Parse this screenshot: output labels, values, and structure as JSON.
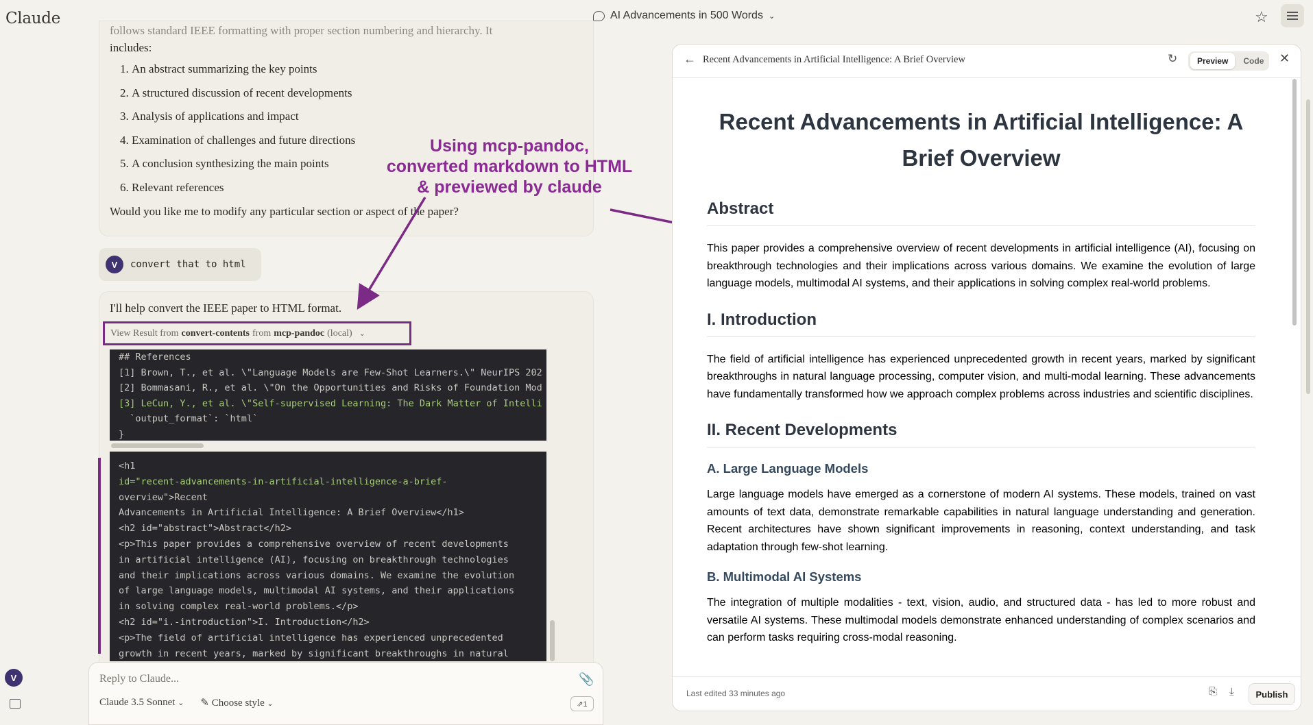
{
  "app": {
    "logo": "Claude",
    "conversation_title": "AI Advancements in 500 Words"
  },
  "assistant_message": {
    "faded_line": "follows standard IEEE formatting with proper section numbering and hierarchy. It",
    "intro_line": "includes:",
    "items": [
      "An abstract summarizing the key points",
      "A structured discussion of recent developments",
      "Analysis of applications and impact",
      "Examination of challenges and future directions",
      "A conclusion synthesizing the main points",
      "Relevant references"
    ],
    "closing": "Would you like me to modify any particular section or aspect of the paper?"
  },
  "user": {
    "avatar": "V",
    "message": "convert that to html"
  },
  "reply": {
    "text": "I'll help convert the IEEE paper to HTML format.",
    "view_result_prefix": "View Result from",
    "tool": "convert-contents",
    "from_word": "from",
    "server": "mcp-pandoc",
    "server_note": "(local)"
  },
  "code_block_1": [
    "## References",
    "[1] Brown, T., et al. \\\"Language Models are Few-Shot Learners.\\\" NeurIPS 202",
    "[2] Bommasani, R., et al. \\\"On the Opportunities and Risks of Foundation Mod",
    "[3] LeCun, Y., et al. \\\"Self-supervised Learning: The Dark Matter of Intelli",
    "  `output_format`: `html`",
    "}"
  ],
  "code_block_2": [
    "<h1",
    "id=\"recent-advancements-in-artificial-intelligence-a-brief-",
    "overview\">Recent",
    "Advancements in Artificial Intelligence: A Brief Overview</h1>",
    "<h2 id=\"abstract\">Abstract</h2>",
    "<p>This paper provides a comprehensive overview of recent developments",
    "in artificial intelligence (AI), focusing on breakthrough technologies",
    "and their implications across various domains. We examine the evolution",
    "of large language models, multimodal AI systems, and their applications",
    "in solving complex real-world problems.</p>",
    "<h2 id=\"i.-introduction\">I. Introduction</h2>",
    "<p>The field of artificial intelligence has experienced unprecedented",
    "growth in recent years, marked by significant breakthroughs in natural"
  ],
  "annotation": {
    "line1": "Using mcp-pandoc,",
    "line2": "converted markdown to HTML",
    "line3": "& previewed by claude"
  },
  "composer": {
    "placeholder": "Reply to Claude...",
    "model": "Claude 3.5 Sonnet",
    "style": "Choose style",
    "badge": "⇗1"
  },
  "sidebar": {
    "avatar": "V"
  },
  "preview": {
    "header_title": "Recent Advancements in Artificial Intelligence: A Brief Overview",
    "toggle_preview": "Preview",
    "toggle_code": "Code",
    "doc": {
      "title": "Recent Advancements in Artificial Intelligence: A Brief Overview",
      "abstract_h": "Abstract",
      "abstract_p": "This paper provides a comprehensive overview of recent developments in artificial intelligence (AI), focusing on breakthrough technologies and their implications across various domains. We examine the evolution of large language models, multimodal AI systems, and their applications in solving complex real-world problems.",
      "intro_h": "I. Introduction",
      "intro_p": "The field of artificial intelligence has experienced unprecedented growth in recent years, marked by significant breakthroughs in natural language processing, computer vision, and multi-modal learning. These advancements have fundamentally transformed how we approach complex problems across industries and scientific disciplines.",
      "dev_h": "II. Recent Developments",
      "llm_h": "A. Large Language Models",
      "llm_p": "Large language models have emerged as a cornerstone of modern AI systems. These models, trained on vast amounts of text data, demonstrate remarkable capabilities in natural language understanding and generation. Recent architectures have shown significant improvements in reasoning, context understanding, and task adaptation through few-shot learning.",
      "mm_h": "B. Multimodal AI Systems",
      "mm_p": "The integration of multiple modalities - text, vision, audio, and structured data - has led to more robust and versatile AI systems. These multimodal models demonstrate enhanced understanding of complex scenarios and can perform tasks requiring cross-modal reasoning."
    },
    "footer_text": "Last edited 33 minutes ago",
    "publish_label": "Publish"
  },
  "colors": {
    "annotation": "#8a2a93",
    "code_bg": "#26252a",
    "string_green": "#a6cd7a",
    "avatar": "#3e3270"
  }
}
